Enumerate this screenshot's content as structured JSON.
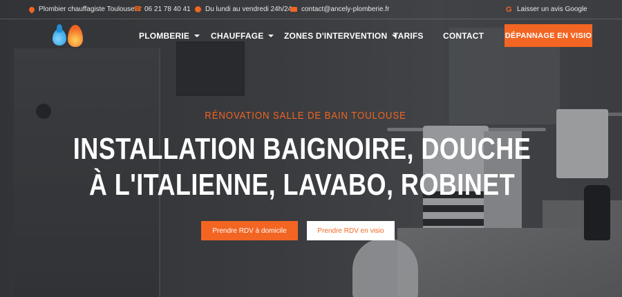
{
  "topbar": {
    "location": "Plombier chauffagiste Toulouse",
    "phone": "06 21 78 40 41",
    "hours": "Du lundi au vendredi 24h/24",
    "email": "contact@ancely-plomberie.fr",
    "review": "Laisser un avis Google"
  },
  "nav": {
    "items": [
      {
        "label": "PLOMBERIE"
      },
      {
        "label": "CHAUFFAGE"
      },
      {
        "label": "ZONES D'INTERVENTION"
      },
      {
        "label": "TARIFS"
      },
      {
        "label": "CONTACT"
      }
    ],
    "cta_label": "DÉPANNAGE EN VISIO"
  },
  "hero": {
    "eyebrow": "RÉNOVATION SALLE DE BAIN TOULOUSE",
    "headline_line1": "INSTALLATION BAIGNOIRE, DOUCHE",
    "headline_line2": "À L'ITALIENNE, LAVABO, ROBINET",
    "btn_home": "Prendre RDV à domicile",
    "btn_visio": "Prendre RDV en visio"
  },
  "colors": {
    "accent": "#f26522",
    "text_light": "#ffffff"
  },
  "icons": [
    "map-pin-icon",
    "phone-icon",
    "clock-icon",
    "mail-icon",
    "google-icon",
    "chevron-down-icon"
  ]
}
